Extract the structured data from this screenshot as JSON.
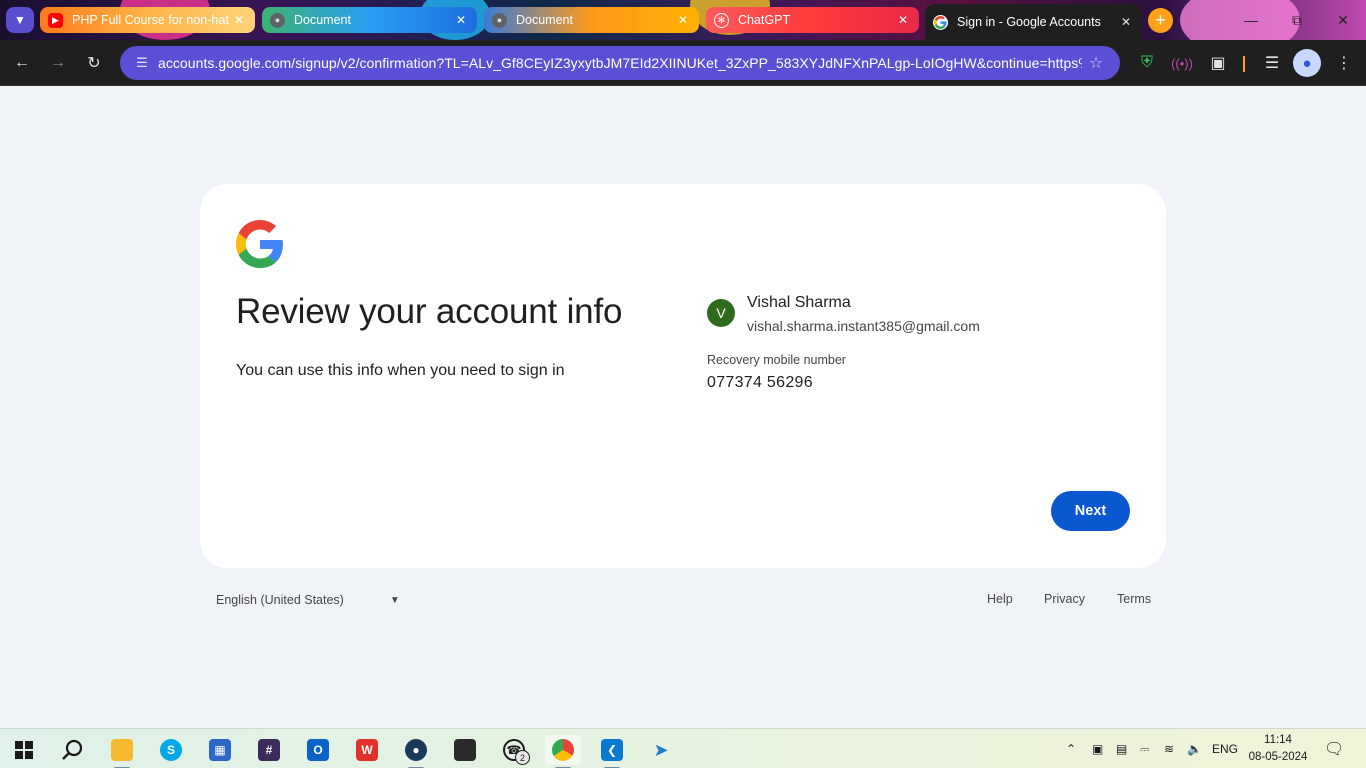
{
  "tabs": [
    {
      "title": "PHP Full Course for non-hat",
      "icon": "youtube-icon"
    },
    {
      "title": "Document",
      "icon": "globe-icon"
    },
    {
      "title": "Document",
      "icon": "globe-icon"
    },
    {
      "title": "ChatGPT",
      "icon": "chatgpt-icon"
    },
    {
      "title": "Sign in - Google Accounts",
      "icon": "google-icon",
      "active": true
    }
  ],
  "toolbar": {
    "url": "accounts.google.com/signup/v2/confirmation?TL=ALv_Gf8CEyIZ3yxytbJM7EId2XIINUKet_3ZxPP_583XYJdNFXnPALgp-LoIOgHW&continue=https%3..."
  },
  "page": {
    "heading": "Review your account info",
    "subtext": "You can use this info when you need to sign in",
    "account": {
      "avatar_letter": "V",
      "name": "Vishal Sharma",
      "email": "vishal.sharma.instant385@gmail.com"
    },
    "recovery": {
      "label": "Recovery mobile number",
      "value": "077374 56296"
    },
    "next_label": "Next"
  },
  "footer": {
    "language": "English (United States)",
    "links": {
      "help": "Help",
      "privacy": "Privacy",
      "terms": "Terms"
    }
  },
  "taskbar": {
    "whatsapp_badge": "2",
    "language_indicator": "ENG",
    "time": "11:14",
    "date": "08-05-2024"
  },
  "colors": {
    "primary_button": "#0b57d0",
    "page_background": "#f0f4f9",
    "avatar": "#2e6b1f",
    "omnibox": "#5b4fd6"
  }
}
